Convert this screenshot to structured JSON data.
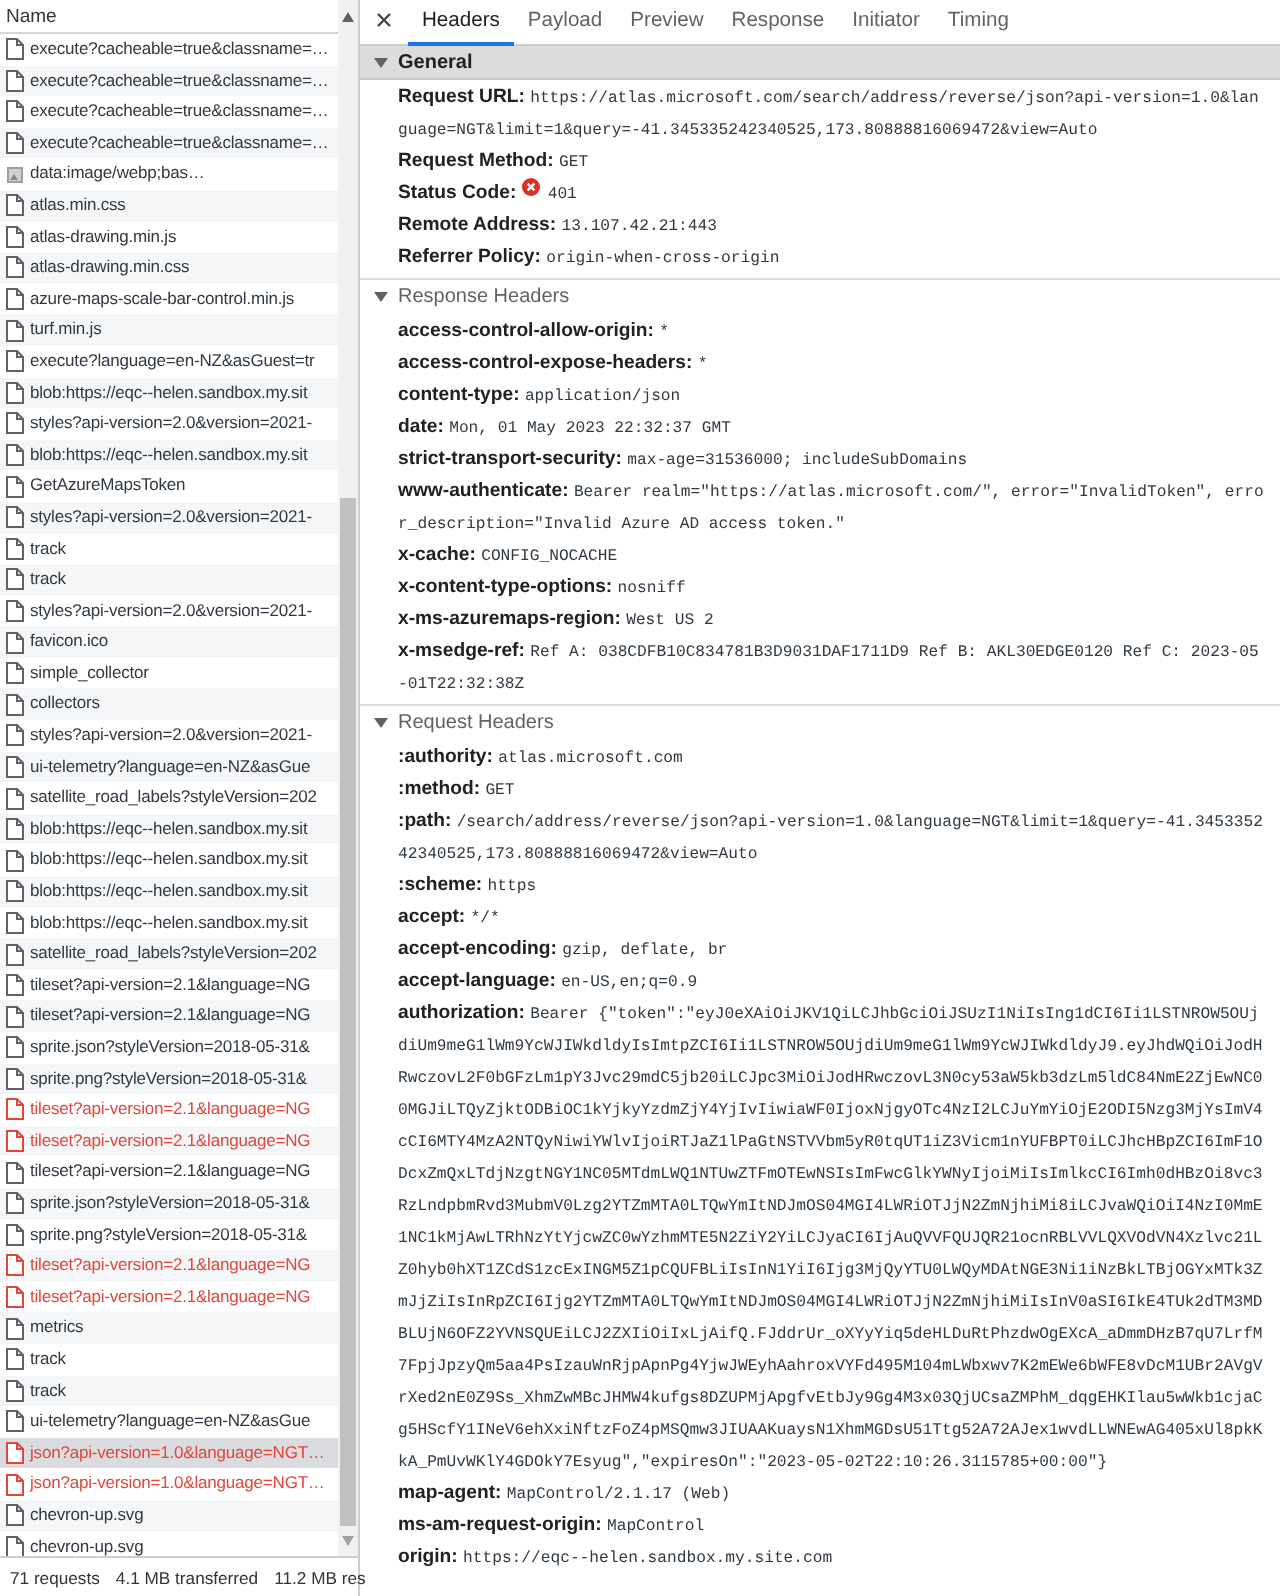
{
  "requests": {
    "column": "Name",
    "rows": [
      {
        "name": "execute?cacheable=true&classname=…",
        "kind": "file",
        "failed": false,
        "selected": false
      },
      {
        "name": "execute?cacheable=true&classname=…",
        "kind": "file",
        "failed": false,
        "selected": false
      },
      {
        "name": "execute?cacheable=true&classname=…",
        "kind": "file",
        "failed": false,
        "selected": false
      },
      {
        "name": "execute?cacheable=true&classname=…",
        "kind": "file",
        "failed": false,
        "selected": false
      },
      {
        "name": "data:image/webp;bas…",
        "kind": "image",
        "failed": false,
        "selected": false
      },
      {
        "name": "atlas.min.css",
        "kind": "file",
        "failed": false,
        "selected": false
      },
      {
        "name": "atlas-drawing.min.js",
        "kind": "file",
        "failed": false,
        "selected": false
      },
      {
        "name": "atlas-drawing.min.css",
        "kind": "file",
        "failed": false,
        "selected": false
      },
      {
        "name": "azure-maps-scale-bar-control.min.js",
        "kind": "file",
        "failed": false,
        "selected": false
      },
      {
        "name": "turf.min.js",
        "kind": "file",
        "failed": false,
        "selected": false
      },
      {
        "name": "execute?language=en-NZ&asGuest=tr",
        "kind": "file",
        "failed": false,
        "selected": false
      },
      {
        "name": "blob:https://eqc--helen.sandbox.my.sit",
        "kind": "file",
        "failed": false,
        "selected": false
      },
      {
        "name": "styles?api-version=2.0&version=2021-",
        "kind": "file",
        "failed": false,
        "selected": false
      },
      {
        "name": "blob:https://eqc--helen.sandbox.my.sit",
        "kind": "file",
        "failed": false,
        "selected": false
      },
      {
        "name": "GetAzureMapsToken",
        "kind": "file",
        "failed": false,
        "selected": false
      },
      {
        "name": "styles?api-version=2.0&version=2021-",
        "kind": "file",
        "failed": false,
        "selected": false
      },
      {
        "name": "track",
        "kind": "file",
        "failed": false,
        "selected": false
      },
      {
        "name": "track",
        "kind": "file",
        "failed": false,
        "selected": false
      },
      {
        "name": "styles?api-version=2.0&version=2021-",
        "kind": "file",
        "failed": false,
        "selected": false
      },
      {
        "name": "favicon.ico",
        "kind": "file",
        "failed": false,
        "selected": false
      },
      {
        "name": "simple_collector",
        "kind": "file",
        "failed": false,
        "selected": false
      },
      {
        "name": "collectors",
        "kind": "file",
        "failed": false,
        "selected": false
      },
      {
        "name": "styles?api-version=2.0&version=2021-",
        "kind": "file",
        "failed": false,
        "selected": false
      },
      {
        "name": "ui-telemetry?language=en-NZ&asGue",
        "kind": "file",
        "failed": false,
        "selected": false
      },
      {
        "name": "satellite_road_labels?styleVersion=202",
        "kind": "file",
        "failed": false,
        "selected": false
      },
      {
        "name": "blob:https://eqc--helen.sandbox.my.sit",
        "kind": "file",
        "failed": false,
        "selected": false
      },
      {
        "name": "blob:https://eqc--helen.sandbox.my.sit",
        "kind": "file",
        "failed": false,
        "selected": false
      },
      {
        "name": "blob:https://eqc--helen.sandbox.my.sit",
        "kind": "file",
        "failed": false,
        "selected": false
      },
      {
        "name": "blob:https://eqc--helen.sandbox.my.sit",
        "kind": "file",
        "failed": false,
        "selected": false
      },
      {
        "name": "satellite_road_labels?styleVersion=202",
        "kind": "file",
        "failed": false,
        "selected": false
      },
      {
        "name": "tileset?api-version=2.1&language=NG",
        "kind": "file",
        "failed": false,
        "selected": false
      },
      {
        "name": "tileset?api-version=2.1&language=NG",
        "kind": "file",
        "failed": false,
        "selected": false
      },
      {
        "name": "sprite.json?styleVersion=2018-05-31&",
        "kind": "file",
        "failed": false,
        "selected": false
      },
      {
        "name": "sprite.png?styleVersion=2018-05-31&",
        "kind": "file",
        "failed": false,
        "selected": false
      },
      {
        "name": "tileset?api-version=2.1&language=NG",
        "kind": "file",
        "failed": true,
        "selected": false
      },
      {
        "name": "tileset?api-version=2.1&language=NG",
        "kind": "file",
        "failed": true,
        "selected": false
      },
      {
        "name": "tileset?api-version=2.1&language=NG",
        "kind": "file",
        "failed": false,
        "selected": false
      },
      {
        "name": "sprite.json?styleVersion=2018-05-31&",
        "kind": "file",
        "failed": false,
        "selected": false
      },
      {
        "name": "sprite.png?styleVersion=2018-05-31&",
        "kind": "file",
        "failed": false,
        "selected": false
      },
      {
        "name": "tileset?api-version=2.1&language=NG",
        "kind": "file",
        "failed": true,
        "selected": false
      },
      {
        "name": "tileset?api-version=2.1&language=NG",
        "kind": "file",
        "failed": true,
        "selected": false
      },
      {
        "name": "metrics",
        "kind": "file",
        "failed": false,
        "selected": false
      },
      {
        "name": "track",
        "kind": "file",
        "failed": false,
        "selected": false
      },
      {
        "name": "track",
        "kind": "file",
        "failed": false,
        "selected": false
      },
      {
        "name": "ui-telemetry?language=en-NZ&asGue",
        "kind": "file",
        "failed": false,
        "selected": false
      },
      {
        "name": "json?api-version=1.0&language=NGT…",
        "kind": "file",
        "failed": true,
        "selected": true
      },
      {
        "name": "json?api-version=1.0&language=NGT…",
        "kind": "file",
        "failed": true,
        "selected": false
      },
      {
        "name": "chevron-up.svg",
        "kind": "file",
        "failed": false,
        "selected": false
      },
      {
        "name": "chevron-up.svg",
        "kind": "file",
        "failed": false,
        "selected": false
      }
    ]
  },
  "status_bar": [
    "71 requests",
    "4.1 MB transferred",
    "11.2 MB res"
  ],
  "tabs": [
    {
      "label": "Headers",
      "selected": true
    },
    {
      "label": "Payload",
      "selected": false
    },
    {
      "label": "Preview",
      "selected": false
    },
    {
      "label": "Response",
      "selected": false
    },
    {
      "label": "Initiator",
      "selected": false
    },
    {
      "label": "Timing",
      "selected": false
    }
  ],
  "sections": [
    {
      "title": "General",
      "expanded": true,
      "focused": true,
      "rows": [
        {
          "label": "Request URL:",
          "value": "https://atlas.microsoft.com/search/address/reverse/json?api-version=1.0&language=NGT&limit=1&query=-41.345335242340525,173.80888816069472&view=Auto"
        },
        {
          "label": "Request Method:",
          "value": "GET"
        },
        {
          "label": "Status Code:",
          "value": "401",
          "kind": "error"
        },
        {
          "label": "Remote Address:",
          "value": "13.107.42.21:443"
        },
        {
          "label": "Referrer Policy:",
          "value": "origin-when-cross-origin"
        }
      ]
    },
    {
      "title": "Response Headers",
      "expanded": true,
      "focused": false,
      "rows": [
        {
          "label": "access-control-allow-origin:",
          "value": "*"
        },
        {
          "label": "access-control-expose-headers:",
          "value": "*"
        },
        {
          "label": "content-type:",
          "value": "application/json"
        },
        {
          "label": "date:",
          "value": "Mon, 01 May 2023 22:32:37 GMT"
        },
        {
          "label": "strict-transport-security:",
          "value": "max-age=31536000; includeSubDomains"
        },
        {
          "label": "www-authenticate:",
          "value": "Bearer realm=\"https://atlas.microsoft.com/\", error=\"InvalidToken\", error_description=\"Invalid Azure AD access token.\""
        },
        {
          "label": "x-cache:",
          "value": "CONFIG_NOCACHE"
        },
        {
          "label": "x-content-type-options:",
          "value": "nosniff"
        },
        {
          "label": "x-ms-azuremaps-region:",
          "value": "West US 2"
        },
        {
          "label": "x-msedge-ref:",
          "value": "Ref A: 038CDFB10C834781B3D9031DAF1711D9 Ref B: AKL30EDGE0120 Ref C: 2023-05-01T22:32:38Z"
        }
      ]
    },
    {
      "title": "Request Headers",
      "expanded": true,
      "focused": false,
      "rows": [
        {
          "label": ":authority:",
          "value": "atlas.microsoft.com"
        },
        {
          "label": ":method:",
          "value": "GET"
        },
        {
          "label": ":path:",
          "value": "/search/address/reverse/json?api-version=1.0&language=NGT&limit=1&query=-41.345335242340525,173.80888816069472&view=Auto"
        },
        {
          "label": ":scheme:",
          "value": "https"
        },
        {
          "label": "accept:",
          "value": "*/*"
        },
        {
          "label": "accept-encoding:",
          "value": "gzip, deflate, br"
        },
        {
          "label": "accept-language:",
          "value": "en-US,en;q=0.9"
        },
        {
          "label": "authorization:",
          "value": "Bearer {\"token\":\"eyJ0eXAiOiJKV1QiLCJhbGciOiJSUzI1NiIsIng1dCI6Ii1LSTNROW5OUjdiUm9meG1lWm9YcWJIWkdldyIsImtpZCI6Ii1LSTNROW5OUjdiUm9meG1lWm9YcWJIWkdldyJ9.eyJhdWQiOiJodHRwczovL2F0bGFzLm1pY3Jvc29mdC5jb20iLCJpc3MiOiJodHRwczovL3N0cy53aW5kb3dzLm5ldC84NmE2ZjEwNC00MGJiLTQyZjktODBiOC1kYjkyYzdmZjY4YjIvIiwiaWF0IjoxNjgyOTc4NzI2LCJuYmYiOjE2ODI5Nzg3MjYsImV4cCI6MTY4MzA2NTQyNiwiYWlvIjoiRTJaZ1lPaGtNSTVVbm5yR0tqUT1iZ3Vicm1nYUFBPT0iLCJhcHBpZCI6ImF1ODcxZmQxLTdjNzgtNGY1NC05MTdmLWQ1NTUwZTFmOTEwNSIsImFwcGlkYWNyIjoiMiIsImlkcCI6Imh0dHBzOi8vc3RzLndpbmRvd3MubmV0Lzg2YTZmMTA0LTQwYmItNDJmOS04MGI4LWRiOTJjN2ZmNjhiMi8iLCJvaWQiOiI4NzI0MmE1NC1kMjAwLTRhNzYtYjcwZC0wYzhmMTE5N2ZiY2YiLCJyaCI6IjAuQVVFQUJQR21ocnRBLVVLQXVOdVN4Xzlvc21LZ0hyb0hXT1ZCdS1zcExINGM5Z1pCQUFBLiIsInN1YiI6Ijg3MjQyYTU0LWQyMDAtNGE3Ni1iNzBkLTBjOGYxMTk3ZmJjZiIsInRpZCI6Ijg2YTZmMTA0LTQwYmItNDJmOS04MGI4LWRiOTJjN2ZmNjhiMiIsInV0aSI6IkE4TUk2dTM3MDBLUjN6OFZ2YVNSQUEiLCJ2ZXIiOiIxLjAifQ.FJddrUr_oXYyYiq5deHLDuRtPhzdwOgEXcA_aDmmDHzB7qU7LrfM7FpjJpzyQm5aa4PsIzauWnRjpApnPg4YjwJWEyhAahroxVYFd495M104mLWbxwv7K2mEWe6bWFE8vDcM1UBr2AVgVrXed2nE0Z9Ss_XhmZwMBcJHMW4kufgs8DZUPMjApgfvEtbJy9Gg4M3x03QjUCsaZMPhM_dqgEHKIlau5wWkb1cjaCg5HScfY1INeV6ehXxiNftzFoZ4pMSQmw3JIUAAKuaysN1XhmMGDsU51Ttg52A72AJex1wvdLLWNEwAG405xUl8pkKkA_PmUvWKlY4GDOkY7Esyug\",\"expiresOn\":\"2023-05-02T22:10:26.3115785+00:00\"}"
        },
        {
          "label": "map-agent:",
          "value": "MapControl/2.1.17 (Web)"
        },
        {
          "label": "ms-am-request-origin:",
          "value": "MapControl"
        },
        {
          "label": "origin:",
          "value": "https://eqc--helen.sandbox.my.site.com"
        }
      ]
    }
  ]
}
